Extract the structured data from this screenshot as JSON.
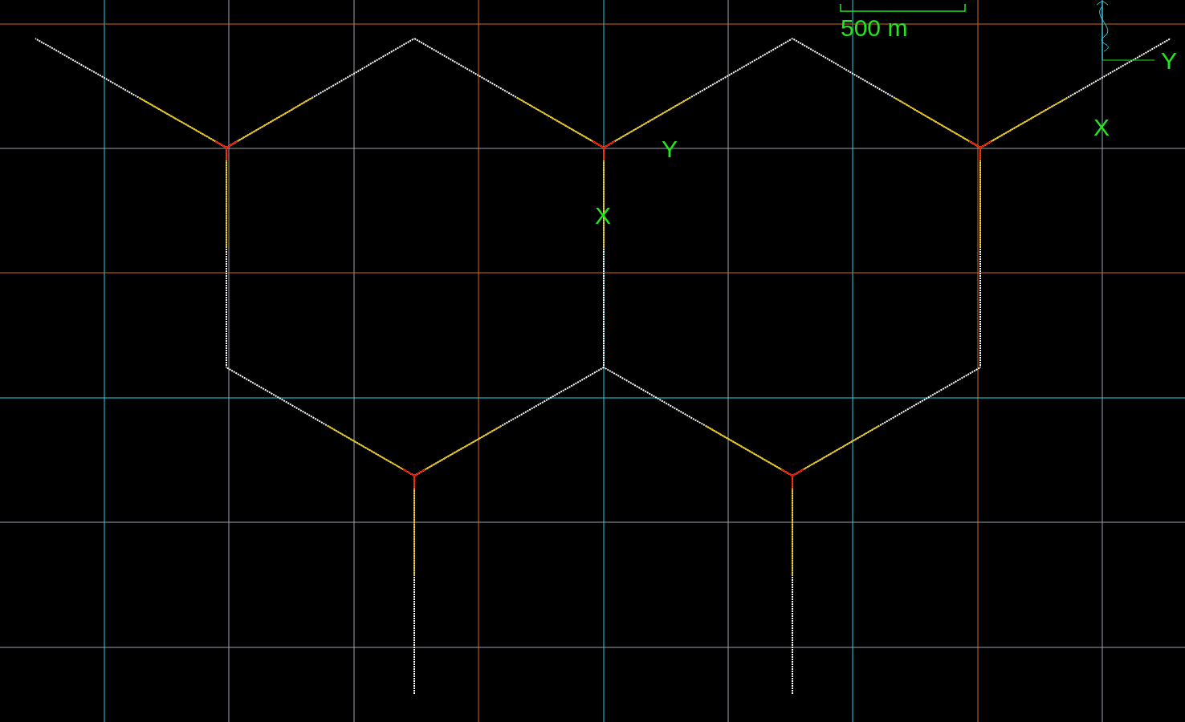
{
  "scale_bar": {
    "label": "500 m"
  },
  "node_labels": [
    {
      "text": "Y"
    },
    {
      "text": "X"
    }
  ],
  "ucs_icon": {
    "y_label": "Y",
    "x_label": "X"
  }
}
